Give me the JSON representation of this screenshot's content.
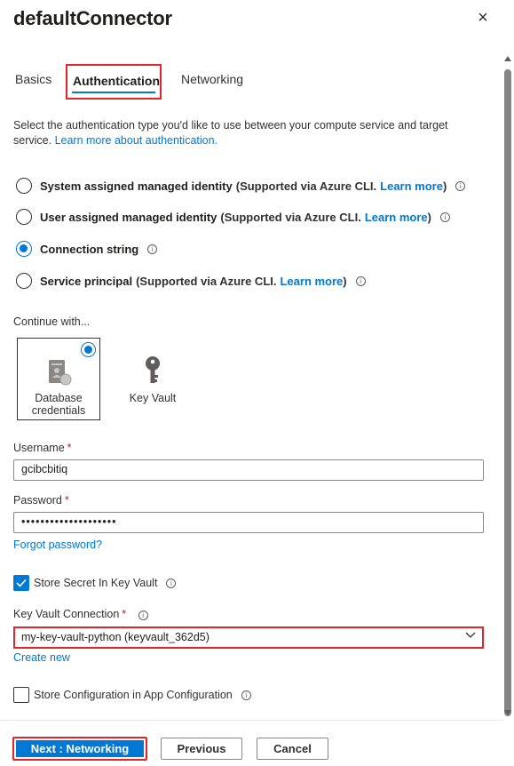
{
  "panel": {
    "title": "defaultConnector",
    "close_label": "×"
  },
  "tabs": [
    {
      "label": "Basics"
    },
    {
      "label": "Authentication"
    },
    {
      "label": "Networking"
    }
  ],
  "description": {
    "text": "Select the authentication type you'd like to use between your compute service and target service.",
    "link": "Learn more about authentication."
  },
  "auth_options": [
    {
      "label": "System assigned managed identity",
      "support": "(Supported via Azure CLI.",
      "link": "Learn more",
      "close": ")",
      "selected": false
    },
    {
      "label": "User assigned managed identity",
      "support": "(Supported via Azure CLI.",
      "link": "Learn more",
      "close": ")",
      "selected": false
    },
    {
      "label": "Connection string",
      "support": "",
      "link": "",
      "close": "",
      "selected": true
    },
    {
      "label": "Service principal",
      "support": "(Supported via Azure CLI.",
      "link": "Learn more",
      "close": ")",
      "selected": false
    }
  ],
  "continue_with": {
    "label": "Continue with...",
    "options": [
      {
        "label_line1": "Database",
        "label_line2": "credentials",
        "selected": true
      },
      {
        "label": "Key Vault",
        "selected": false
      }
    ]
  },
  "username": {
    "label": "Username",
    "required_mark": "*",
    "value": "gcibcbitiq"
  },
  "password": {
    "label": "Password",
    "required_mark": "*",
    "value": "••••••••••••••••••••",
    "forgot_link": "Forgot password?"
  },
  "store_secret": {
    "label": "Store Secret In Key Vault",
    "checked": true
  },
  "key_vault_connection": {
    "label": "Key Vault Connection",
    "required_mark": "*",
    "value": "my-key-vault-python (keyvault_362d5)",
    "create_new": "Create new"
  },
  "store_config": {
    "label": "Store Configuration in App Configuration",
    "checked": false
  },
  "footer": {
    "next_label": "Next : Networking",
    "previous_label": "Previous",
    "cancel_label": "Cancel"
  },
  "colors": {
    "accent": "#0078d4",
    "highlight": "#e3242b",
    "required": "#a4262c"
  }
}
